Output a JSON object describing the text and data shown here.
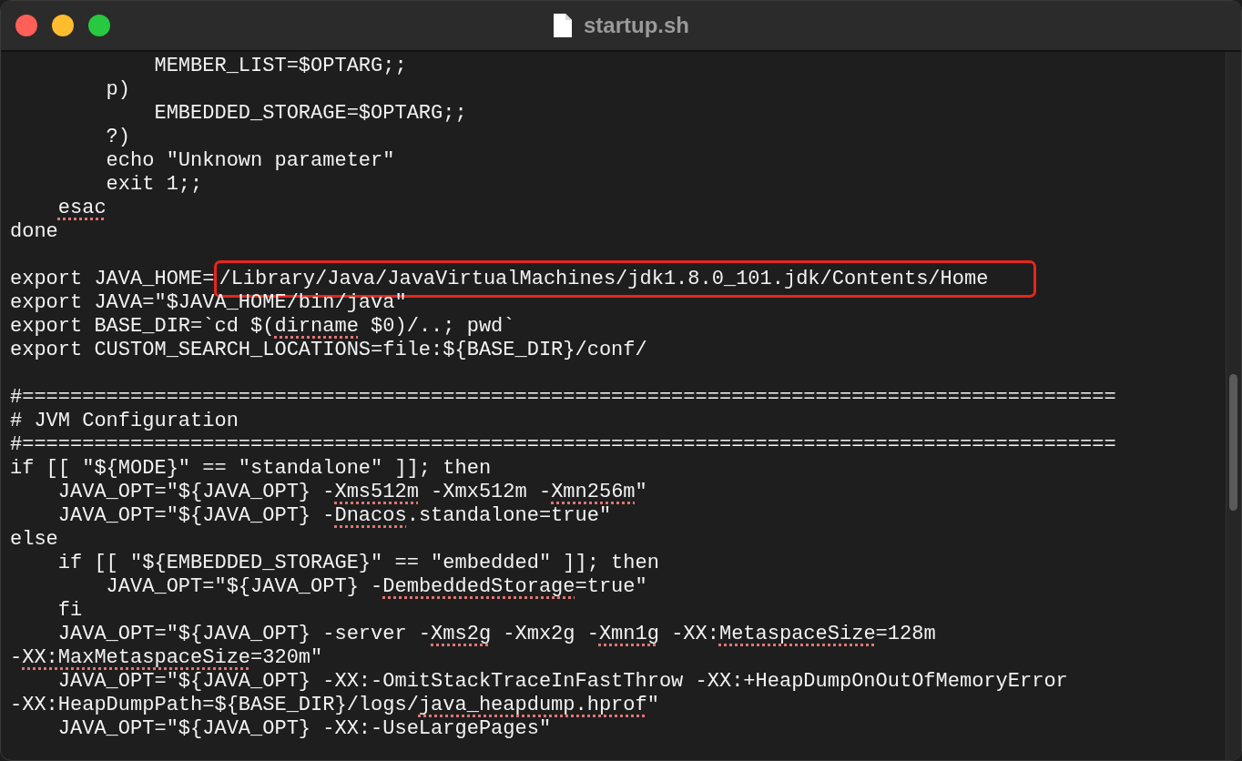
{
  "window": {
    "title": "startup.sh"
  },
  "lines": [
    {
      "kind": "code",
      "parts": [
        {
          "text": "            MEMBER_LIST=$OPTARG;;"
        }
      ]
    },
    {
      "kind": "code",
      "parts": [
        {
          "text": "        p)"
        }
      ]
    },
    {
      "kind": "code",
      "parts": [
        {
          "text": "            EMBEDDED_STORAGE=$OPTARG;;"
        }
      ]
    },
    {
      "kind": "code",
      "parts": [
        {
          "text": "        ?)"
        }
      ]
    },
    {
      "kind": "code",
      "parts": [
        {
          "text": "        echo \"Unknown parameter\""
        }
      ]
    },
    {
      "kind": "code",
      "parts": [
        {
          "text": "        exit 1;;"
        }
      ]
    },
    {
      "kind": "code",
      "parts": [
        {
          "text": "    esac",
          "flagged": true
        }
      ]
    },
    {
      "kind": "code",
      "parts": [
        {
          "text": "done"
        }
      ]
    },
    {
      "kind": "blank"
    },
    {
      "kind": "code",
      "parts": [
        {
          "text": "export JAVA_HOME="
        },
        {
          "text": "/Library/Java/JavaVirtualMachines/jdk1.8.0_101.jdk/Contents/Home",
          "highlighted": true
        }
      ]
    },
    {
      "kind": "code",
      "parts": [
        {
          "text": "export JAVA=\"$JAVA_HOME/bin/java\""
        }
      ]
    },
    {
      "kind": "code",
      "parts": [
        {
          "text": "export BASE_DIR=`cd $("
        },
        {
          "text": "dirname",
          "flagged": true
        },
        {
          "text": " $0)/..; pwd`"
        }
      ]
    },
    {
      "kind": "code",
      "parts": [
        {
          "text": "export CUSTOM_SEARCH_LOCATIONS=file:${BASE_DIR}/conf/"
        }
      ]
    },
    {
      "kind": "blank"
    },
    {
      "kind": "code",
      "parts": [
        {
          "text": "#==========================================================================================="
        }
      ]
    },
    {
      "kind": "code",
      "parts": [
        {
          "text": "# JVM Configuration"
        }
      ]
    },
    {
      "kind": "code",
      "parts": [
        {
          "text": "#==========================================================================================="
        }
      ]
    },
    {
      "kind": "code",
      "parts": [
        {
          "text": "if [[ \"${MODE}\" == \"standalone\" ]]; then"
        }
      ]
    },
    {
      "kind": "code",
      "parts": [
        {
          "text": "    JAVA_OPT=\"${JAVA_OPT} -"
        },
        {
          "text": "Xms512m",
          "flagged": true
        },
        {
          "text": " -Xmx512m -"
        },
        {
          "text": "Xmn256m",
          "flagged": true
        },
        {
          "text": "\""
        }
      ]
    },
    {
      "kind": "code",
      "parts": [
        {
          "text": "    JAVA_OPT=\"${JAVA_OPT} -"
        },
        {
          "text": "Dnacos",
          "flagged": true
        },
        {
          "text": ".standalone=true\""
        }
      ]
    },
    {
      "kind": "code",
      "parts": [
        {
          "text": "else"
        }
      ]
    },
    {
      "kind": "code",
      "parts": [
        {
          "text": "    if [[ \"${EMBEDDED_STORAGE}\" == \"embedded\" ]]; then"
        }
      ]
    },
    {
      "kind": "code",
      "parts": [
        {
          "text": "        JAVA_OPT=\"${JAVA_OPT} -"
        },
        {
          "text": "DembeddedStorage",
          "flagged": true
        },
        {
          "text": "=true\""
        }
      ]
    },
    {
      "kind": "code",
      "parts": [
        {
          "text": "    fi"
        }
      ]
    },
    {
      "kind": "code",
      "parts": [
        {
          "text": "    JAVA_OPT=\"${JAVA_OPT} -server -"
        },
        {
          "text": "Xms2g",
          "flagged": true
        },
        {
          "text": " -Xmx2g -"
        },
        {
          "text": "Xmn1g",
          "flagged": true
        },
        {
          "text": " -XX:"
        },
        {
          "text": "MetaspaceSize",
          "flagged": true
        },
        {
          "text": "=128m"
        }
      ]
    },
    {
      "kind": "code",
      "parts": [
        {
          "text": "-"
        },
        {
          "text": "XX:MaxMetaspaceSize",
          "flagged": true
        },
        {
          "text": "=320m\""
        }
      ]
    },
    {
      "kind": "code",
      "parts": [
        {
          "text": "    JAVA_OPT=\"${JAVA_OPT} -XX:-OmitStackTraceInFastThrow -XX:+HeapDumpOnOutOfMemoryError"
        }
      ]
    },
    {
      "kind": "code",
      "parts": [
        {
          "text": "-XX:HeapDumpPath=${BASE_DIR}/logs/"
        },
        {
          "text": "java_heapdump.hprof",
          "flagged": true
        },
        {
          "text": "\""
        }
      ]
    },
    {
      "kind": "code",
      "parts": [
        {
          "text": "    JAVA_OPT=\"${JAVA_OPT} -XX:-UseLargePages\""
        }
      ]
    }
  ]
}
